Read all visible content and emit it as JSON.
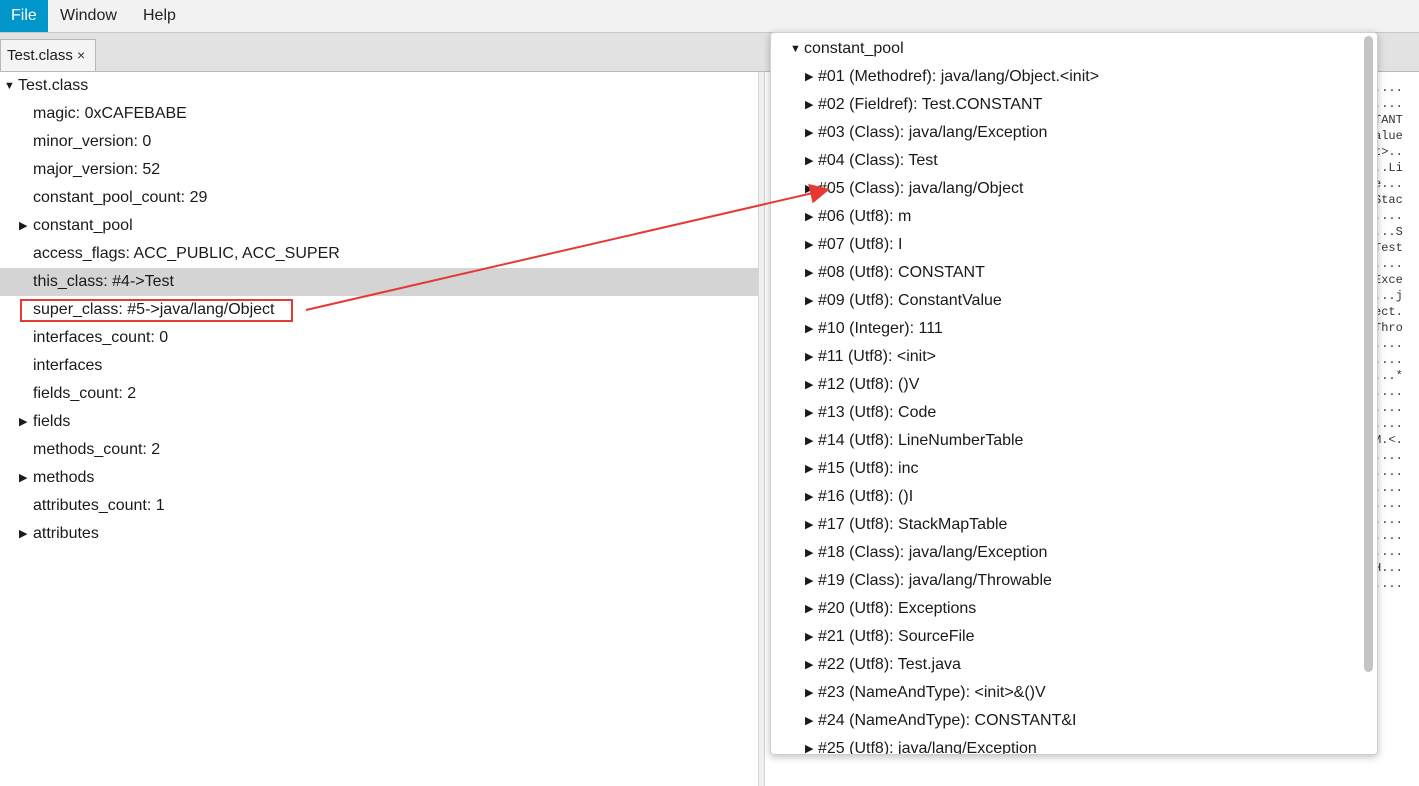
{
  "menu": {
    "file": "File",
    "window": "Window",
    "help": "Help"
  },
  "tab": {
    "label": "Test.class",
    "close": "×"
  },
  "tree": {
    "root": "Test.class",
    "items": [
      "magic: 0xCAFEBABE",
      "minor_version: 0",
      "major_version: 52",
      "constant_pool_count: 29",
      "constant_pool",
      "access_flags: ACC_PUBLIC, ACC_SUPER",
      "this_class: #4->Test",
      "super_class: #5->java/lang/Object",
      "interfaces_count: 0",
      "interfaces",
      "fields_count: 2",
      "fields",
      "methods_count: 2",
      "methods",
      "attributes_count: 1",
      "attributes"
    ]
  },
  "popup": {
    "root": "constant_pool",
    "items": [
      "#01 (Methodref): java/lang/Object.<init>",
      "#02 (Fieldref): Test.CONSTANT",
      "#03 (Class): java/lang/Exception",
      "#04 (Class): Test",
      "#05 (Class): java/lang/Object",
      "#06 (Utf8): m",
      "#07 (Utf8): I",
      "#08 (Utf8): CONSTANT",
      "#09 (Utf8): ConstantValue",
      "#10 (Integer): 111",
      "#11 (Utf8): <init>",
      "#12 (Utf8): ()V",
      "#13 (Utf8): Code",
      "#14 (Utf8): LineNumberTable",
      "#15 (Utf8): inc",
      "#16 (Utf8): ()I",
      "#17 (Utf8): StackMapTable",
      "#18 (Class): java/lang/Exception",
      "#19 (Class): java/lang/Throwable",
      "#20 (Utf8): Exceptions",
      "#21 (Utf8): SourceFile",
      "#22 (Utf8): Test.java",
      "#23 (NameAndType): <init>&()V",
      "#24 (NameAndType): CONSTANT&I",
      "#25 (Utf8): java/lang/Exception"
    ]
  },
  "hex": [
    "....",
    "....",
    "TANT",
    "alue",
    "t>..",
    "..Li",
    "e...",
    "Stac",
    "....",
    "...S",
    "Test",
    "....",
    "Exce",
    "...j",
    "ect.",
    "Thro",
    "....",
    "....",
    "...*",
    "....",
    "....",
    "....",
    "M.<.",
    "....",
    "....",
    "....",
    "....",
    "....",
    "....",
    "....",
    "H...",
    "...."
  ],
  "colors": {
    "accent": "#0096c9",
    "highlight": "#e53935",
    "selected": "#d4d4d4"
  }
}
